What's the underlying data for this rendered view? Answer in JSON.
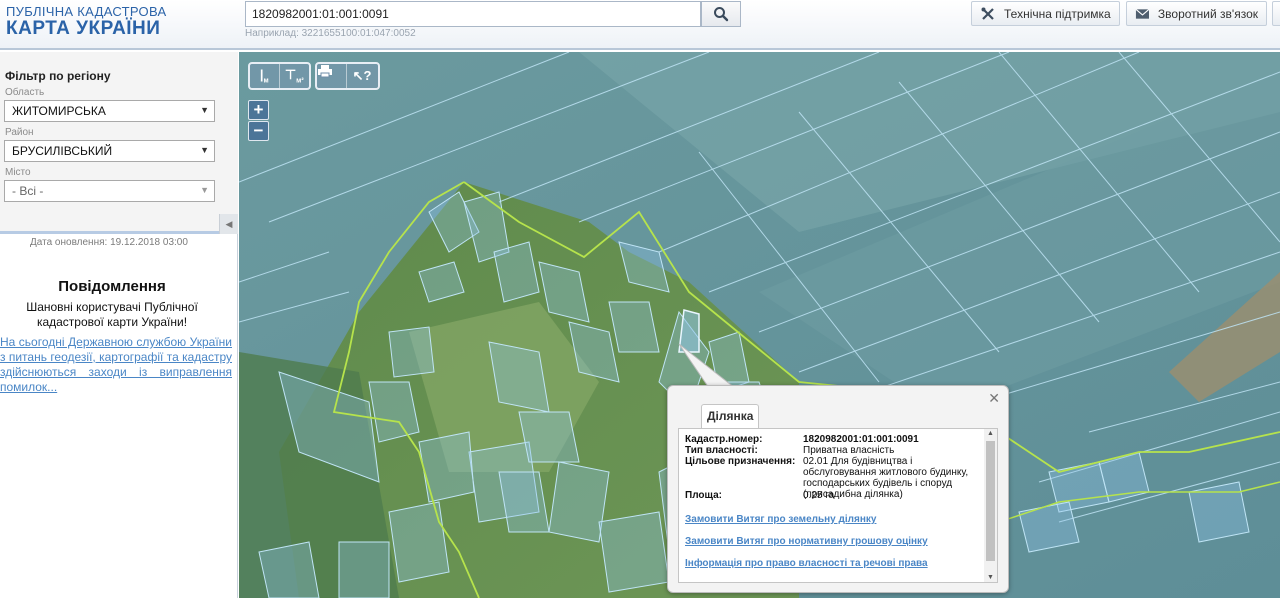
{
  "header": {
    "logo_line1": "ПУБЛІЧНА КАДАСТРОВА",
    "logo_line2": "КАРТА УКРАЇНИ",
    "search_value": "1820982001:01:001:0091",
    "search_hint": "Наприклад: 3221655100:01:047:0052",
    "support_label": "Технічна підтримка",
    "feedback_label": "Зворотний зв'язок"
  },
  "sidebar": {
    "filter_title": "Фільтр по регіону",
    "region_label": "Область",
    "region_value": "ЖИТОМИРСЬКА",
    "district_label": "Район",
    "district_value": "БРУСИЛІВСЬКИЙ",
    "city_label": "Місто",
    "city_value": "- Всі -",
    "update_date": "Дата оновлення: 19.12.2018 03:00",
    "notice_title": "Повідомлення",
    "notice_text": "Шановні користувачі Публічної кадастрової карти України!",
    "notice_link": "На сьогодні Державною службою України з питань геодезії, картографії та кадастру здійснюються заходи із виправлення помилок..."
  },
  "map": {
    "zoom_in": "+",
    "zoom_out": "−",
    "tools": [
      "measure-distance",
      "measure-area",
      "print",
      "identify"
    ]
  },
  "popup": {
    "tab": "Ділянка",
    "rows": [
      {
        "key": "Кадастр.номер:",
        "value": "1820982001:01:001:0091",
        "bold": true
      },
      {
        "key": "Тип власності:",
        "value": "Приватна власність"
      },
      {
        "key": "Цільове призначення:",
        "value": "02.01 Для будівництва і обслуговування житлового будинку, господарських будівель і споруд (присадибна ділянка)"
      },
      {
        "key": "Площа:",
        "value": "0.25 га"
      }
    ],
    "links": [
      "Замовити Витяг про земельну ділянку",
      "Замовити Витяг про нормативну грошову оцінку",
      "Інформація про право власності та речові права"
    ]
  },
  "colors": {
    "brand_blue": "#2b63a8",
    "link": "#4a86c6",
    "parcel_fill": "#8fc4e8",
    "village_border": "#b6e34c"
  }
}
